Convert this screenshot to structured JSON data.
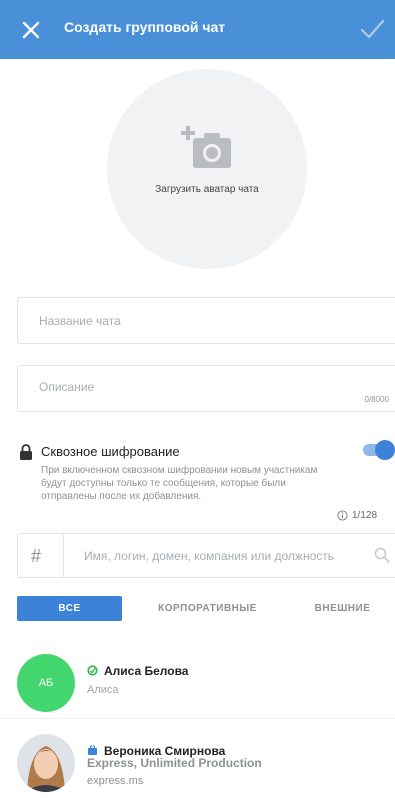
{
  "header": {
    "title": "Создать групповой чат",
    "bg_color": "#4a90d9"
  },
  "avatar": {
    "upload_label": "Загрузить аватар чата"
  },
  "form": {
    "name_placeholder": "Название чата",
    "name_value": "",
    "description_placeholder": "Описание",
    "description_value": "",
    "description_counter": "0/8000"
  },
  "encryption": {
    "label": "Сквозное шифрование",
    "enabled": true,
    "description": "При включенном сквозном шифровании новым участникам будут доступны только те сообщения, которые были отправлены после их добавления."
  },
  "members": {
    "counter": "1/128"
  },
  "search": {
    "prefix": "#",
    "placeholder": "Имя, логин, домен, компания или должность"
  },
  "tabs": [
    {
      "label": "ВСЕ",
      "active": true
    },
    {
      "label": "КОРПОРАТИВНЫЕ",
      "active": false
    },
    {
      "label": "ВНЕШНИЕ",
      "active": false
    }
  ],
  "contacts": [
    {
      "initials": "АБ",
      "name": "Алиса Белова",
      "subtitle": "Алиса",
      "status_icon": "online-status-icon",
      "avatar_color": "#44d66e"
    },
    {
      "name": "Вероника Смирнова",
      "company": "Express, Unlimited Production",
      "domain": "express.ms",
      "status_icon": "corporate-badge-icon"
    }
  ],
  "colors": {
    "accent": "#3b82d8",
    "online": "#2eb84f"
  }
}
